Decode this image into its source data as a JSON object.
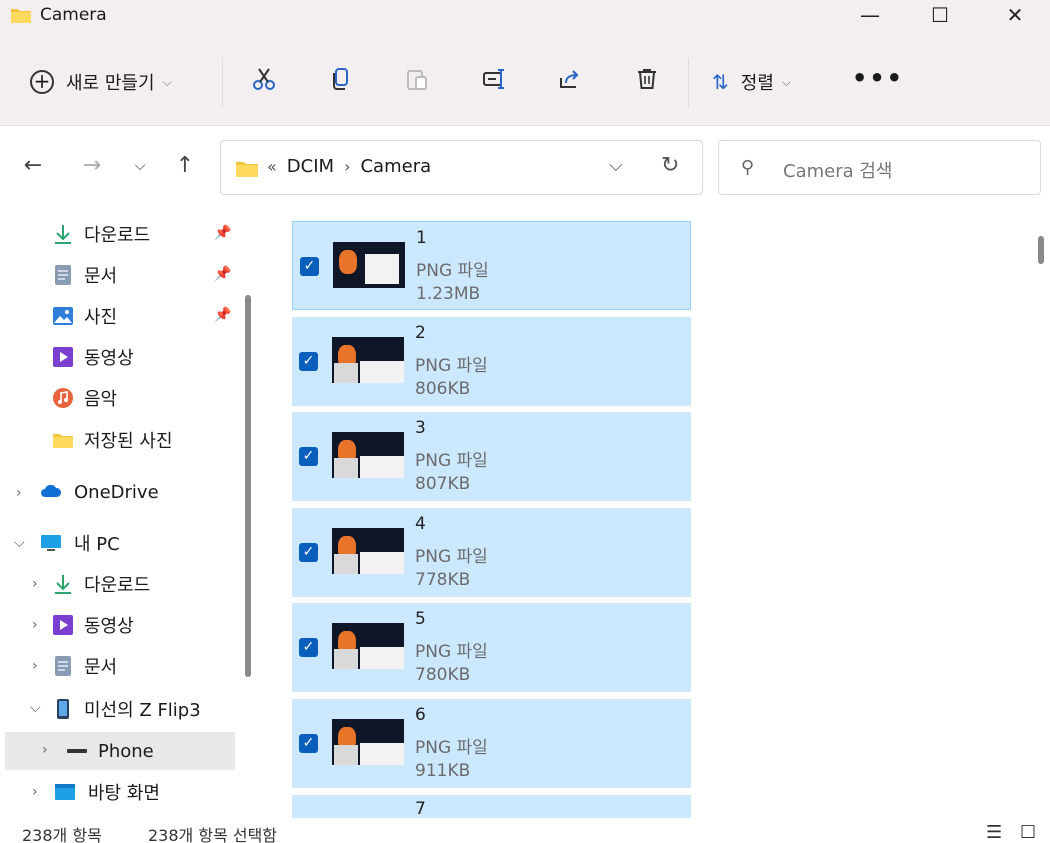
{
  "window": {
    "title": "Camera",
    "min": "—",
    "max": "☐",
    "close": "✕"
  },
  "toolbar": {
    "new_label": "새로 만들기",
    "sort_label": "정렬",
    "more": "•••"
  },
  "address": {
    "overflow": "«",
    "crumbs": [
      "DCIM",
      "Camera"
    ]
  },
  "search": {
    "placeholder": "Camera 검색"
  },
  "sidebar": {
    "quick": [
      {
        "label": "다운로드",
        "icon": "download-icon"
      },
      {
        "label": "문서",
        "icon": "document-icon"
      },
      {
        "label": "사진",
        "icon": "pictures-icon"
      },
      {
        "label": "동영상",
        "icon": "video-icon"
      },
      {
        "label": "음악",
        "icon": "music-icon"
      },
      {
        "label": "저장된 사진",
        "icon": "folder-icon"
      }
    ],
    "onedrive": "OneDrive",
    "pc": "내 PC",
    "pc_children": [
      {
        "label": "다운로드",
        "icon": "download-icon"
      },
      {
        "label": "동영상",
        "icon": "video-icon"
      },
      {
        "label": "문서",
        "icon": "document-icon"
      },
      {
        "label": "미선의 Z Flip3",
        "icon": "phone-icon"
      },
      {
        "label": "Phone",
        "icon": "storage-icon"
      },
      {
        "label": "바탕 화면",
        "icon": "desktop-icon"
      }
    ]
  },
  "files": [
    {
      "name": "1",
      "type": "PNG 파일",
      "size": "1.23MB"
    },
    {
      "name": "2",
      "type": "PNG 파일",
      "size": "806KB"
    },
    {
      "name": "3",
      "type": "PNG 파일",
      "size": "807KB"
    },
    {
      "name": "4",
      "type": "PNG 파일",
      "size": "778KB"
    },
    {
      "name": "5",
      "type": "PNG 파일",
      "size": "780KB"
    },
    {
      "name": "6",
      "type": "PNG 파일",
      "size": "911KB"
    },
    {
      "name": "7",
      "type": "",
      "size": ""
    }
  ],
  "status": {
    "count": "238개 항목",
    "selected": "238개 항목 선택함"
  },
  "colors": {
    "selection": "#cce8ff",
    "checkbox": "#0a5fbd",
    "accent": "#2b65c8"
  }
}
